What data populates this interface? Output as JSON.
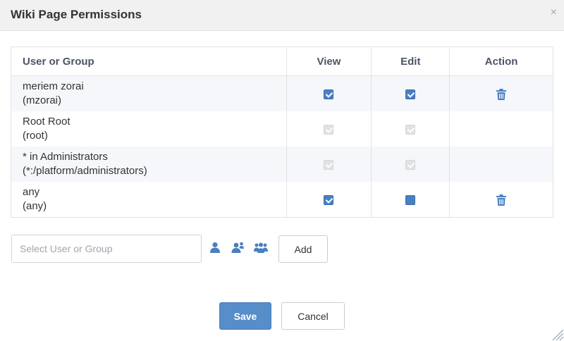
{
  "dialog": {
    "title": "Wiki Page Permissions",
    "close_glyph": "×"
  },
  "table": {
    "headers": {
      "user": "User or Group",
      "view": "View",
      "edit": "Edit",
      "action": "Action"
    },
    "rows": [
      {
        "name": "meriem zorai",
        "id": "(mzorai)",
        "view": "checked",
        "edit": "checked",
        "deletable": true
      },
      {
        "name": "Root Root",
        "id": "(root)",
        "view": "disabled",
        "edit": "disabled",
        "deletable": false
      },
      {
        "name": "* in Administrators",
        "id": "(*:/platform/administrators)",
        "view": "disabled",
        "edit": "disabled",
        "deletable": false
      },
      {
        "name": "any",
        "id": "(any)",
        "view": "checked",
        "edit": "unchecked-focused",
        "deletable": true
      }
    ]
  },
  "add_form": {
    "search_value": "",
    "search_placeholder": "Select User or Group",
    "icons": [
      "user-icon",
      "membership-icon",
      "group-icon"
    ],
    "add_label": "Add"
  },
  "footer": {
    "save_label": "Save",
    "cancel_label": "Cancel"
  },
  "colors": {
    "accent": "#578dc9",
    "icon": "#4a7fc0",
    "title_bar": "#f1f1f1"
  }
}
